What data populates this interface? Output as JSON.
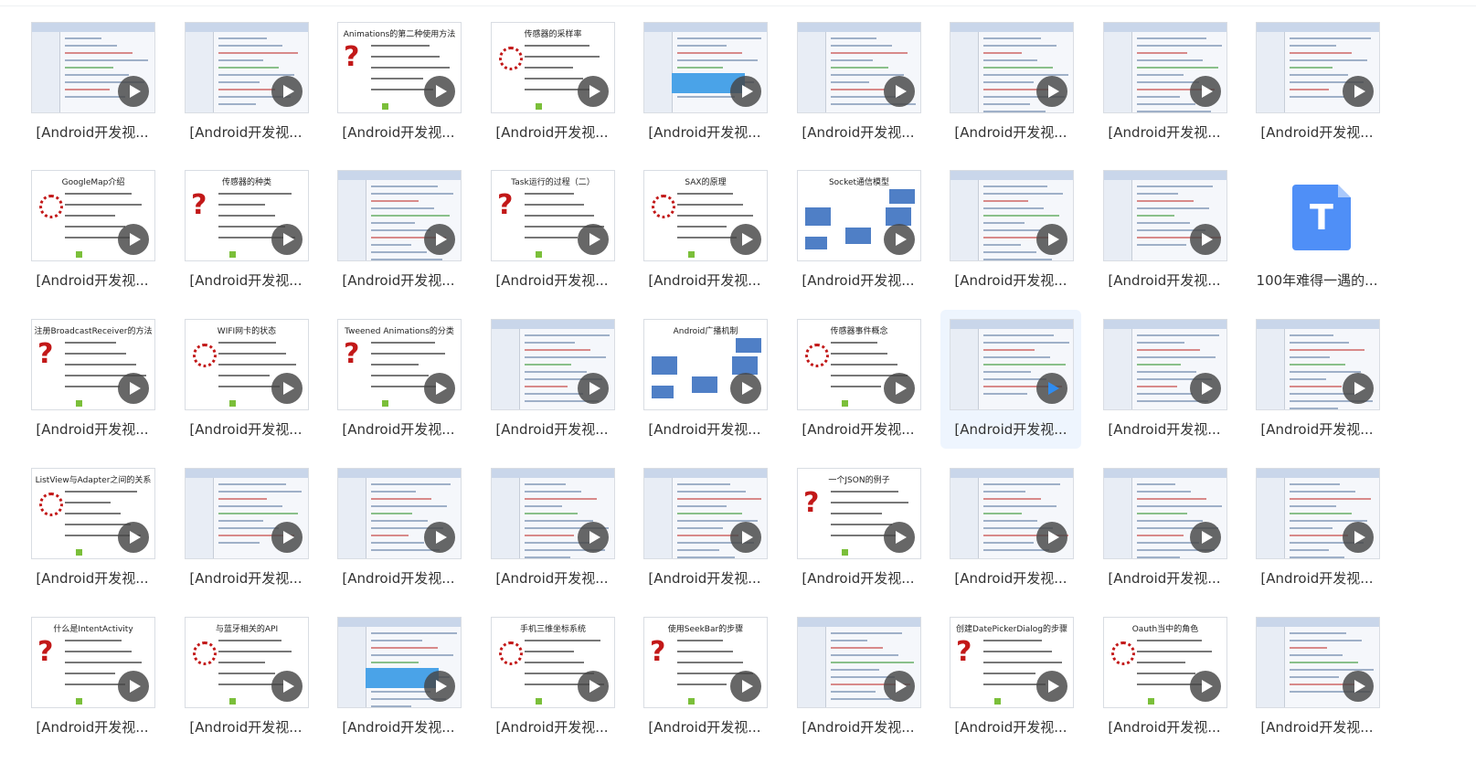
{
  "items": [
    {
      "name": "[Android开发视...",
      "kind": "ide"
    },
    {
      "name": "[Android开发视...",
      "kind": "ide"
    },
    {
      "name": "[Android开发视...",
      "kind": "slide",
      "title": "Animations的第二种使用方法"
    },
    {
      "name": "[Android开发视...",
      "kind": "slide",
      "title": "传感器的采样率"
    },
    {
      "name": "[Android开发视...",
      "kind": "ide"
    },
    {
      "name": "[Android开发视...",
      "kind": "ide"
    },
    {
      "name": "[Android开发视...",
      "kind": "ide"
    },
    {
      "name": "[Android开发视...",
      "kind": "ide"
    },
    {
      "name": "[Android开发视...",
      "kind": "ide"
    },
    {
      "name": "[Android开发视...",
      "kind": "slide",
      "title": "GoogleMap介绍"
    },
    {
      "name": "[Android开发视...",
      "kind": "slide",
      "title": "传感器的种类"
    },
    {
      "name": "[Android开发视...",
      "kind": "ide"
    },
    {
      "name": "[Android开发视...",
      "kind": "slide",
      "title": "Task运行的过程（二）"
    },
    {
      "name": "[Android开发视...",
      "kind": "slide",
      "title": "SAX的原理"
    },
    {
      "name": "[Android开发视...",
      "kind": "diagram",
      "title": "Socket通信模型"
    },
    {
      "name": "[Android开发视...",
      "kind": "ide"
    },
    {
      "name": "[Android开发视...",
      "kind": "ide"
    },
    {
      "name": "100年难得一遇的...",
      "kind": "file"
    },
    {
      "name": "[Android开发视...",
      "kind": "slide",
      "title": "注册BroadcastReceiver的方法"
    },
    {
      "name": "[Android开发视...",
      "kind": "slide",
      "title": "WIFI网卡的状态"
    },
    {
      "name": "[Android开发视...",
      "kind": "slide",
      "title": "Tweened Animations的分类"
    },
    {
      "name": "[Android开发视...",
      "kind": "ide"
    },
    {
      "name": "[Android开发视...",
      "kind": "diagram",
      "title": "Android广播机制"
    },
    {
      "name": "[Android开发视...",
      "kind": "slide",
      "title": "传感器事件概念"
    },
    {
      "name": "[Android开发视...",
      "kind": "ide",
      "selected": true
    },
    {
      "name": "[Android开发视...",
      "kind": "ide"
    },
    {
      "name": "[Android开发视...",
      "kind": "ide"
    },
    {
      "name": "[Android开发视...",
      "kind": "slide",
      "title": "ListView与Adapter之间的关系"
    },
    {
      "name": "[Android开发视...",
      "kind": "ide"
    },
    {
      "name": "[Android开发视...",
      "kind": "ide"
    },
    {
      "name": "[Android开发视...",
      "kind": "ide"
    },
    {
      "name": "[Android开发视...",
      "kind": "ide"
    },
    {
      "name": "[Android开发视...",
      "kind": "slide",
      "title": "一个JSON的例子"
    },
    {
      "name": "[Android开发视...",
      "kind": "ide"
    },
    {
      "name": "[Android开发视...",
      "kind": "ide"
    },
    {
      "name": "[Android开发视...",
      "kind": "ide"
    },
    {
      "name": "[Android开发视...",
      "kind": "slide",
      "title": "什么是IntentActivity"
    },
    {
      "name": "[Android开发视...",
      "kind": "slide",
      "title": "与蓝牙相关的API"
    },
    {
      "name": "[Android开发视...",
      "kind": "ide"
    },
    {
      "name": "[Android开发视...",
      "kind": "slide",
      "title": "手机三维坐标系统"
    },
    {
      "name": "[Android开发视...",
      "kind": "slide",
      "title": "使用SeekBar的步骤"
    },
    {
      "name": "[Android开发视...",
      "kind": "ide"
    },
    {
      "name": "[Android开发视...",
      "kind": "slide",
      "title": "创建DatePickerDialog的步骤"
    },
    {
      "name": "[Android开发视...",
      "kind": "slide",
      "title": "Oauth当中的角色"
    },
    {
      "name": "[Android开发视...",
      "kind": "ide"
    }
  ],
  "file_icon_letter": "T",
  "colors": {
    "accent": "#2f8cf0",
    "selected_bg": "#eef5fe",
    "file_icon": "#4f8ff7"
  }
}
